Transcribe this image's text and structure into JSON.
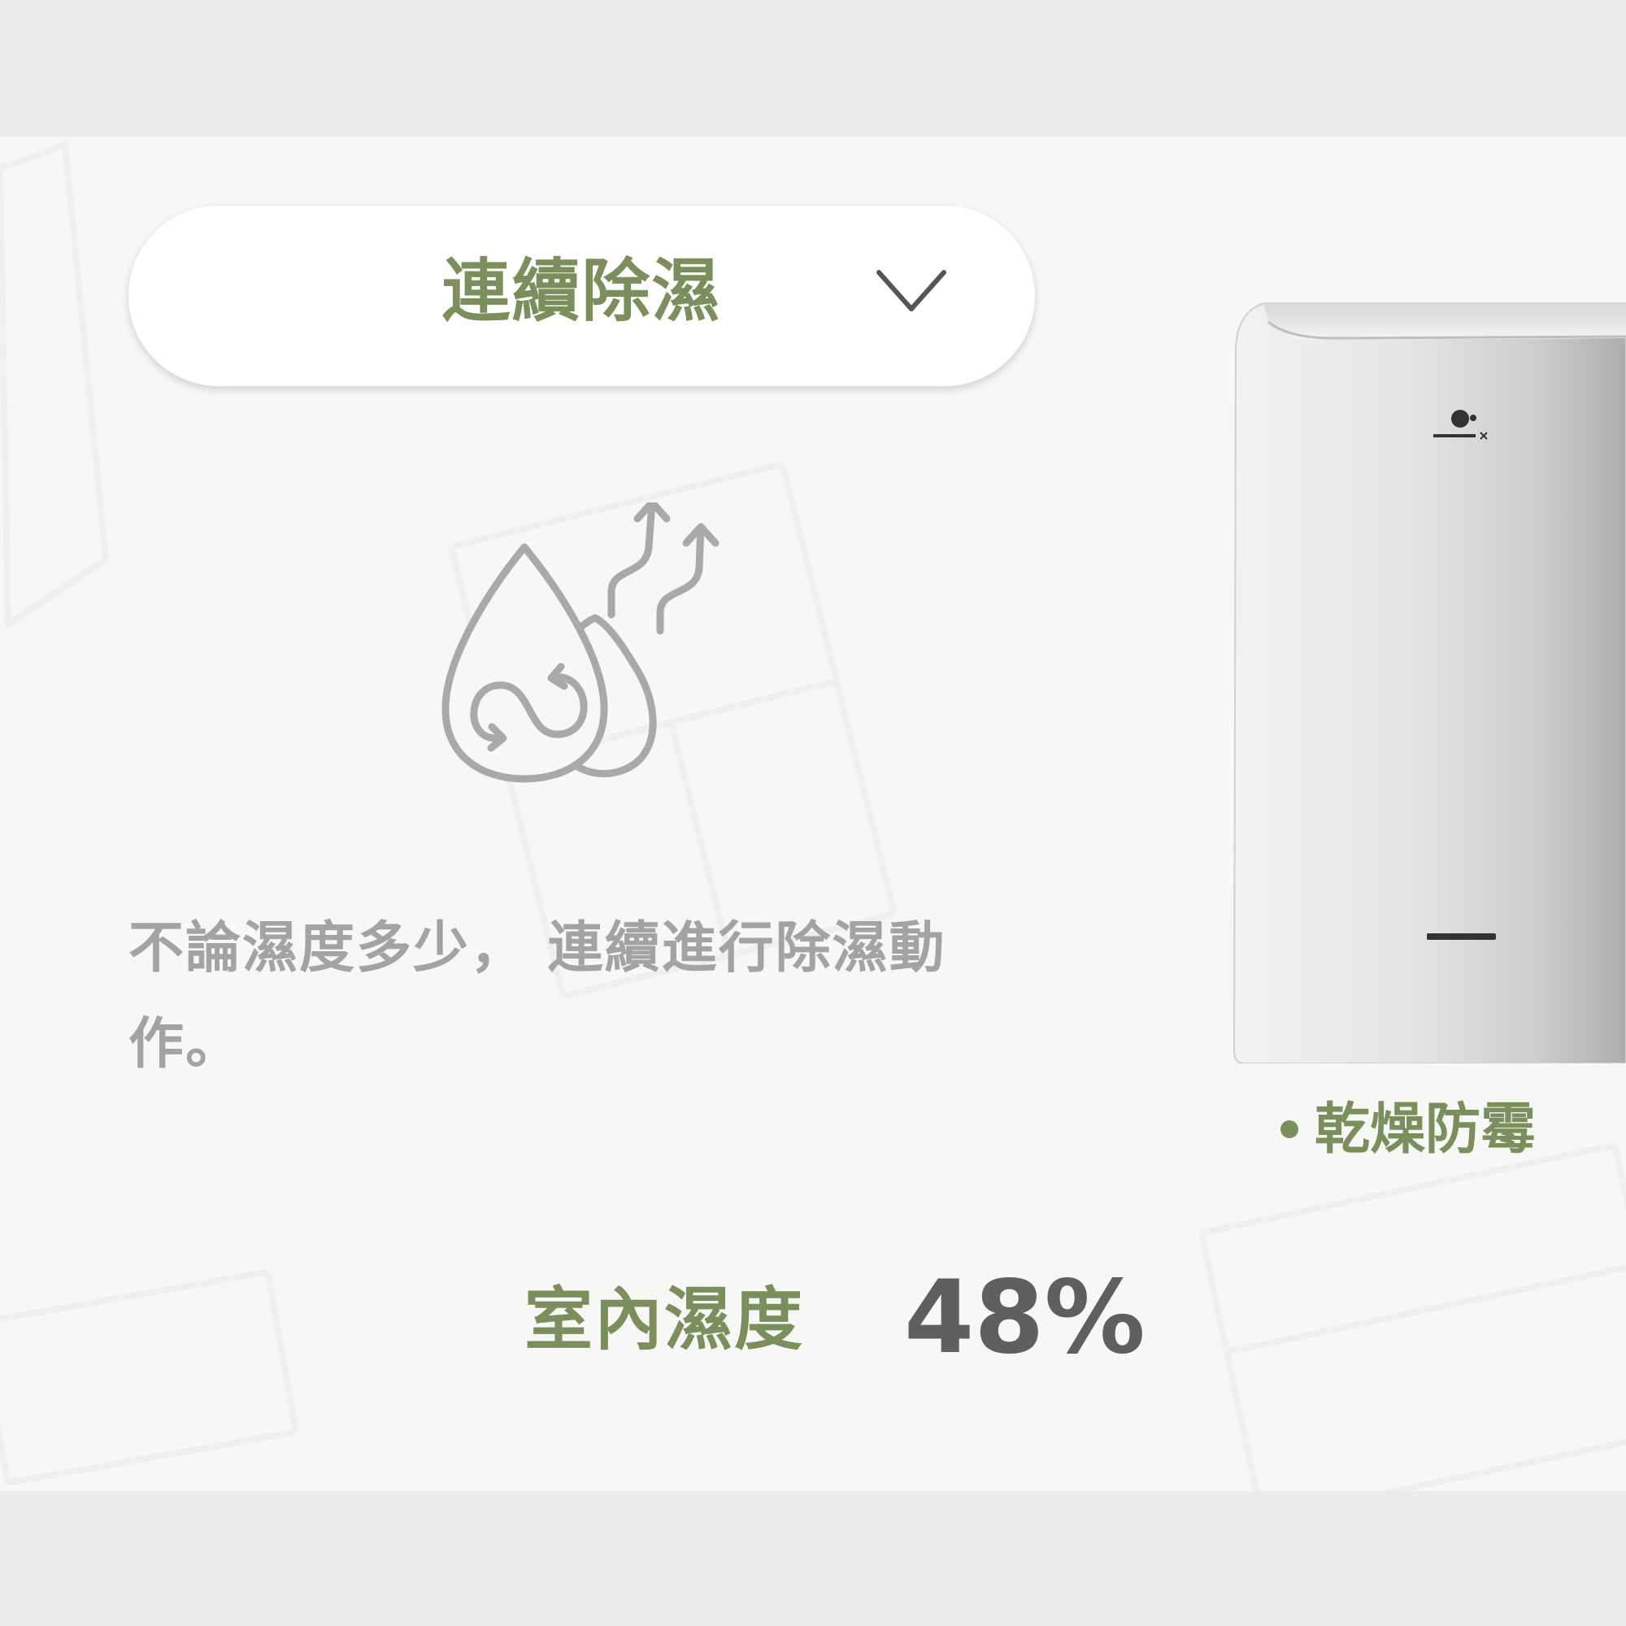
{
  "mode_selector": {
    "label": "連續除濕",
    "icon": "chevron-down-icon"
  },
  "mode_icon": "continuous-dehumidify-icon",
  "description": {
    "line1": "不論濕度多少， 連續進行除濕動",
    "line2": "作。"
  },
  "device": {
    "image": "dehumidifier-image",
    "logo_icon": "brand-logo-icon"
  },
  "feature": {
    "label": "乾燥防霉"
  },
  "humidity": {
    "label": "室內濕度",
    "value": "48%"
  },
  "colors": {
    "accent": "#7b8f5c",
    "text_muted": "#a3a3a3",
    "value_text": "#5f5f5f",
    "panel_bg": "#f7f7f6",
    "outer_bg": "#ebebea"
  }
}
